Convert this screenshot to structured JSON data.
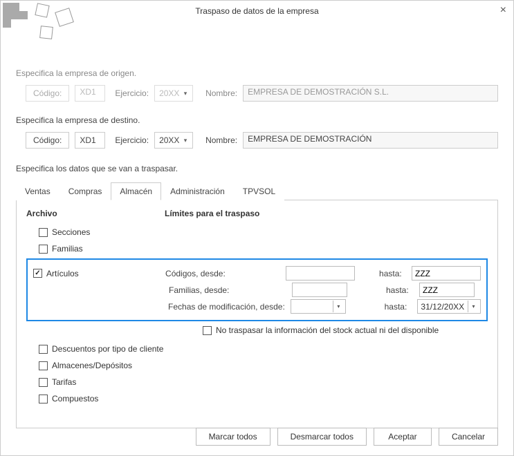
{
  "window": {
    "title": "Traspaso de datos de la empresa"
  },
  "origin": {
    "section_label": "Especifica la empresa de origen.",
    "code_label": "Código:",
    "code_value": "XD1",
    "year_label": "Ejercicio:",
    "year_value": "20XX",
    "name_label": "Nombre:",
    "name_value": "EMPRESA DE DEMOSTRACIÓN S.L."
  },
  "dest": {
    "section_label": "Especifica la empresa de destino.",
    "code_label": "Código:",
    "code_value": "XD1",
    "year_label": "Ejercicio:",
    "year_value": "20XX",
    "name_label": "Nombre:",
    "name_value": "EMPRESA DE DEMOSTRACIÓN"
  },
  "transfer_label": "Especifica los datos que se van a traspasar.",
  "tabs": {
    "ventas": "Ventas",
    "compras": "Compras",
    "almacen": "Almacén",
    "administracion": "Administración",
    "tpvsol": "TPVSOL"
  },
  "panel": {
    "col_archivo": "Archivo",
    "col_limites": "Límites para el traspaso",
    "items": {
      "secciones": "Secciones",
      "familias": "Familias",
      "articulos": "Artículos",
      "descuentos": "Descuentos por tipo de cliente",
      "almacenes": "Almacenes/Depósitos",
      "tarifas": "Tarifas",
      "compuestos": "Compuestos"
    },
    "limits": {
      "codigos_desde": "Códigos, desde:",
      "familias_desde": "Familias, desde:",
      "fechas_desde": "Fechas de modificación, desde:",
      "hasta": "hasta:",
      "codigos_from": "",
      "codigos_to": "ZZZ",
      "familias_from": "",
      "familias_to": "ZZZ",
      "fechas_from": "",
      "fechas_to": "31/12/20XX"
    },
    "no_stock": "No traspasar la información del stock actual ni del disponible"
  },
  "buttons": {
    "marcar": "Marcar todos",
    "desmarcar": "Desmarcar todos",
    "aceptar": "Aceptar",
    "cancelar": "Cancelar"
  }
}
